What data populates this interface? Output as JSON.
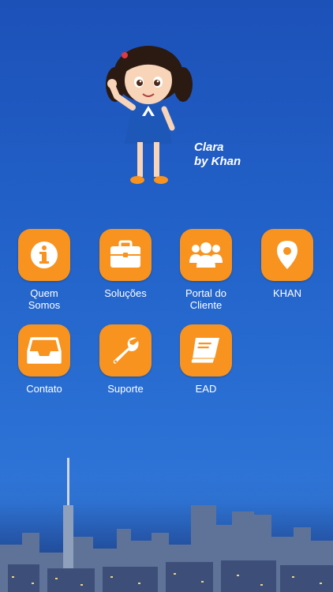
{
  "mascot": {
    "caption_line1": "Clara",
    "caption_line2": "by Khan"
  },
  "menu": [
    {
      "label": "Quem\nSomos",
      "icon": "info-icon"
    },
    {
      "label": "Soluções",
      "icon": "briefcase-icon"
    },
    {
      "label": "Portal do\nCliente",
      "icon": "users-icon"
    },
    {
      "label": "KHAN",
      "icon": "map-pin-icon"
    },
    {
      "label": "Contato",
      "icon": "inbox-icon"
    },
    {
      "label": "Suporte",
      "icon": "wrench-icon"
    },
    {
      "label": "EAD",
      "icon": "book-icon"
    }
  ],
  "colors": {
    "button": "#f7931e",
    "background_top": "#1c51b8",
    "background_bottom": "#2f76d8"
  }
}
